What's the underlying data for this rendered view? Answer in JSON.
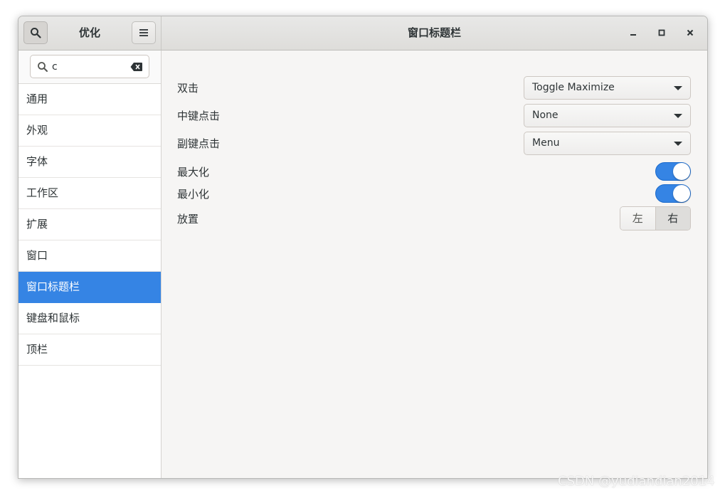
{
  "window": {
    "left_title": "优化",
    "title": "窗口标题栏"
  },
  "search": {
    "value": "c"
  },
  "sidebar": {
    "items": [
      {
        "label": "通用"
      },
      {
        "label": "外观"
      },
      {
        "label": "字体"
      },
      {
        "label": "工作区"
      },
      {
        "label": "扩展"
      },
      {
        "label": "窗口"
      },
      {
        "label": "窗口标题栏",
        "selected": true
      },
      {
        "label": "键盘和鼠标"
      },
      {
        "label": "顶栏"
      }
    ]
  },
  "settings": {
    "double_click": {
      "label": "双击",
      "value": "Toggle Maximize"
    },
    "middle_click": {
      "label": "中键点击",
      "value": "None"
    },
    "secondary_click": {
      "label": "副键点击",
      "value": "Menu"
    },
    "maximize": {
      "label": "最大化",
      "enabled": true
    },
    "minimize": {
      "label": "最小化",
      "enabled": true
    },
    "placement": {
      "label": "放置",
      "options": [
        "左",
        "右"
      ],
      "selected": "右"
    }
  },
  "watermark": "CSDN @yudiandian2014",
  "colors": {
    "accent": "#3584e4",
    "window_bg": "#f6f5f4",
    "text": "#2e3436"
  },
  "icons": {
    "search": "search-icon",
    "menu": "hamburger-menu-icon",
    "minimize": "minimize-icon",
    "maximize": "maximize-icon",
    "close": "close-icon",
    "clear": "backspace-clear-icon",
    "dropdown": "dropdown-arrow-icon"
  }
}
